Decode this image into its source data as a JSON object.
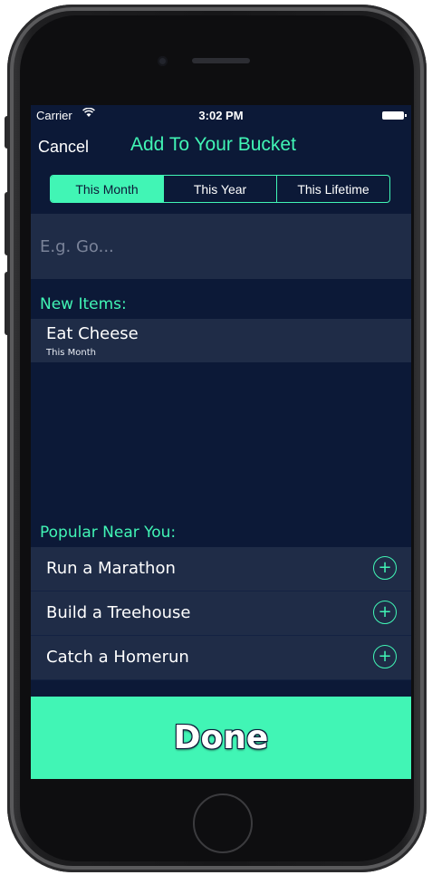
{
  "status_bar": {
    "carrier": "Carrier",
    "wifi_icon": "wifi-icon",
    "time": "3:02 PM",
    "battery_icon": "battery-icon"
  },
  "nav": {
    "cancel_label": "Cancel",
    "title": "Add To Your Bucket"
  },
  "segments": [
    {
      "label": "This Month",
      "selected": true
    },
    {
      "label": "This Year",
      "selected": false
    },
    {
      "label": "This Lifetime",
      "selected": false
    }
  ],
  "input": {
    "placeholder": "E.g. Go...",
    "value": ""
  },
  "new_items": {
    "header": "New Items:",
    "items": [
      {
        "title": "Eat Cheese",
        "subtitle": "This Month"
      }
    ]
  },
  "popular": {
    "header": "Popular Near You:",
    "items": [
      {
        "title": "Run a Marathon",
        "icon": "add-circle-icon"
      },
      {
        "title": "Build a Treehouse",
        "icon": "add-circle-icon"
      },
      {
        "title": "Catch a Homerun",
        "icon": "add-circle-icon"
      }
    ]
  },
  "done_label": "Done",
  "colors": {
    "accent": "#41f5b5",
    "background": "#0c1937",
    "cell": "#1f2c47"
  }
}
